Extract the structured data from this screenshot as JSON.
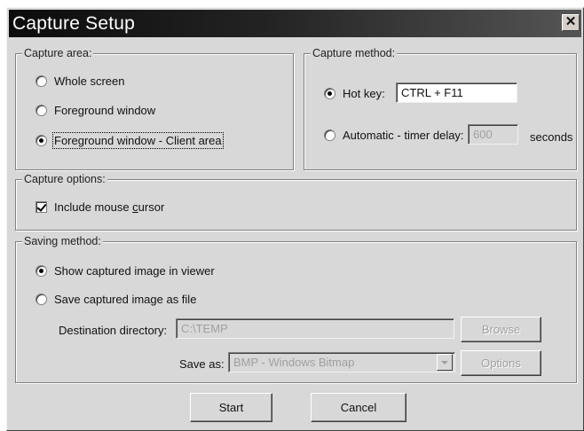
{
  "window": {
    "title": "Capture Setup",
    "close_glyph": "✕"
  },
  "capture_area": {
    "legend": "Capture area:",
    "options": [
      {
        "label": "Whole screen",
        "selected": false
      },
      {
        "label": "Foreground window",
        "selected": false
      },
      {
        "label": "Foreground window - Client area",
        "selected": true
      }
    ]
  },
  "capture_method": {
    "legend": "Capture method:",
    "hotkey": {
      "label": "Hot key:",
      "value": "CTRL + F11",
      "selected": true
    },
    "automatic": {
      "label": "Automatic - timer delay:",
      "value": "600",
      "unit": "seconds",
      "selected": false
    }
  },
  "capture_options": {
    "legend": "Capture options:",
    "include_cursor": {
      "label_before": "Include mouse ",
      "label_accel": "c",
      "label_after": "ursor",
      "checked": true
    }
  },
  "saving_method": {
    "legend": "Saving method:",
    "show_in_viewer": {
      "label": "Show captured image in viewer",
      "selected": true
    },
    "save_as_file": {
      "label": "Save captured image as file",
      "selected": false
    },
    "destination": {
      "label": "Destination directory:",
      "value": "C:\\TEMP"
    },
    "browse_label": "Browse",
    "save_as": {
      "label": "Save as:",
      "value": "BMP - Windows Bitmap"
    },
    "options_label": "Options"
  },
  "buttons": {
    "start": "Start",
    "cancel": "Cancel"
  }
}
